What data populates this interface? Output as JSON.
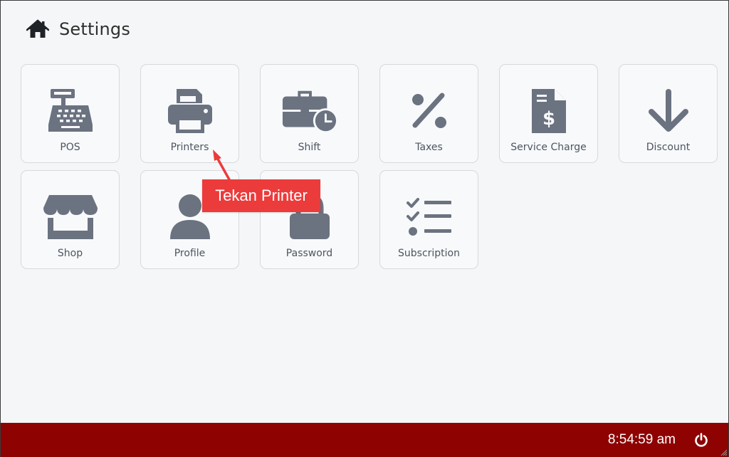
{
  "header": {
    "title": "Settings",
    "icon": "home-icon"
  },
  "tiles": [
    {
      "label": "POS",
      "icon": "cash-register-icon"
    },
    {
      "label": "Printers",
      "icon": "printer-icon"
    },
    {
      "label": "Shift",
      "icon": "briefcase-clock-icon"
    },
    {
      "label": "Taxes",
      "icon": "percent-icon"
    },
    {
      "label": "Service Charge",
      "icon": "receipt-dollar-icon"
    },
    {
      "label": "Discount",
      "icon": "arrow-down-icon"
    },
    {
      "label": "Shop",
      "icon": "store-icon"
    },
    {
      "label": "Profile",
      "icon": "user-icon"
    },
    {
      "label": "Password",
      "icon": "lock-icon"
    },
    {
      "label": "Subscription",
      "icon": "checklist-icon"
    }
  ],
  "callout": {
    "text": "Tekan Printer",
    "color": "#ec3b3b"
  },
  "footer": {
    "clock": "8:54:59 am",
    "power_icon": "power-icon",
    "background": "#8e0202"
  },
  "colors": {
    "icon": "#6b7280",
    "background": "#f5f6f8"
  }
}
